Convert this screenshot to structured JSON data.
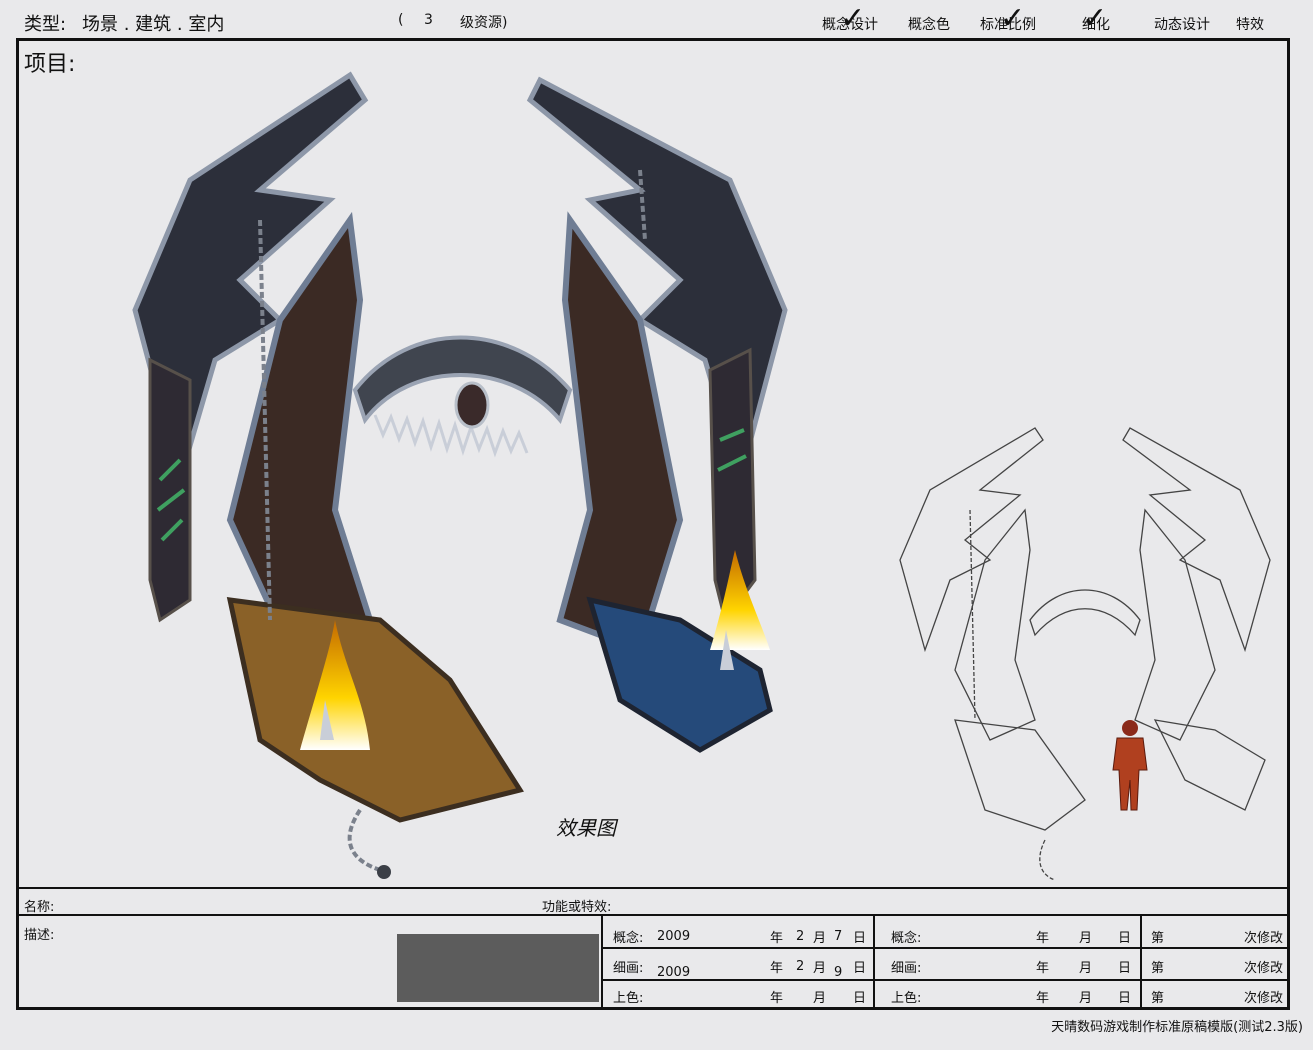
{
  "header": {
    "type_label": "类型:",
    "type_value": "场景 . 建筑 . 室内",
    "level_open": "(",
    "level_number": "3",
    "level_text": "级资源)",
    "stages": [
      "概念设计",
      "概念色",
      "标准比例",
      "细化",
      "动态设计",
      "特效"
    ],
    "checked_stages": [
      0,
      2,
      3
    ]
  },
  "project_label": "项目:",
  "stamp_text": "效果图",
  "form": {
    "name_label": "名称:",
    "function_label": "功能或特效:",
    "desc_label": "描述:",
    "concept_label": "概念:",
    "concept_year": "2009",
    "concept_month": "2",
    "concept_day": "7",
    "detail_label": "细画:",
    "detail_year": "2009",
    "detail_month": "2",
    "detail_day": "9",
    "color_label": "上色:",
    "year_char": "年",
    "month_char": "月",
    "day_char": "日",
    "revision_prefix": "第",
    "revision_suffix": "次修改"
  },
  "footer": "天晴数码游戏制作标准原稿模版(测试2.3版)",
  "colors": {
    "frame": "#111111",
    "bg": "#e9e9eb",
    "redacted": "#5c5c5c"
  }
}
